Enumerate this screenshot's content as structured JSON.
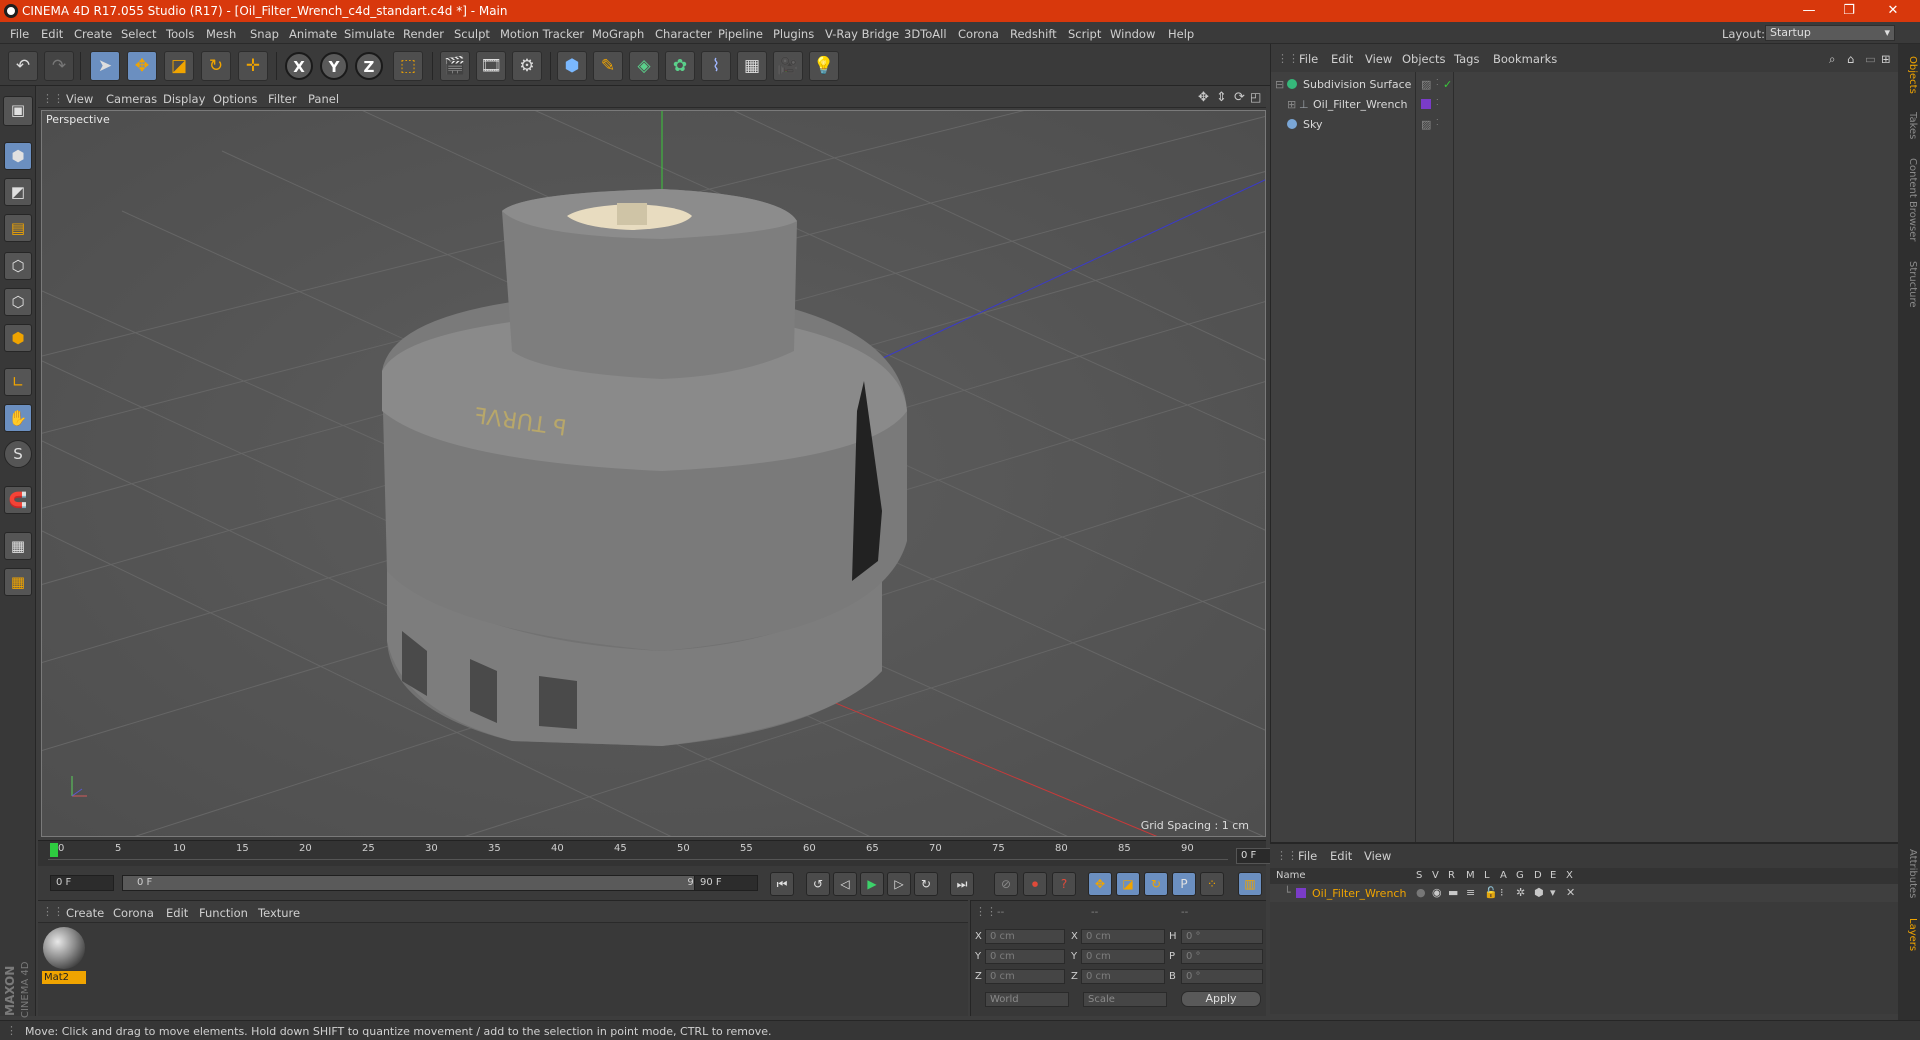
{
  "window": {
    "title": "CINEMA 4D R17.055 Studio (R17) - [Oil_Filter_Wrench_c4d_standart.c4d *] - Main",
    "min_symbol": "—",
    "restore_symbol": "❐",
    "close_symbol": "✕"
  },
  "menubar": {
    "items": [
      "File",
      "Edit",
      "Create",
      "Select",
      "Tools",
      "Mesh",
      "Snap",
      "Animate",
      "Simulate",
      "Render",
      "Sculpt",
      "Motion Tracker",
      "MoGraph",
      "Character",
      "Pipeline",
      "Plugins",
      "V-Ray Bridge",
      "3DToAll",
      "Corona",
      "Redshift",
      "Script",
      "Window",
      "Help"
    ],
    "layout_label": "Layout:",
    "layout_value": "Startup"
  },
  "toolbar": {
    "x_label": "X",
    "y_label": "Y",
    "z_label": "Z"
  },
  "viewport": {
    "menu": [
      "View",
      "Cameras",
      "Display",
      "Options",
      "Filter",
      "Panel"
    ],
    "label": "Perspective",
    "grid_spacing": "Grid Spacing : 1 cm"
  },
  "timeline": {
    "ticks": [
      "0",
      "5",
      "10",
      "15",
      "20",
      "25",
      "30",
      "35",
      "40",
      "45",
      "50",
      "55",
      "60",
      "65",
      "70",
      "75",
      "80",
      "85",
      "90"
    ],
    "current_frame": "0 F",
    "start_field": "0 F",
    "range_start": "0 F",
    "range_end": "90 F",
    "end_field": "90 F"
  },
  "materials": {
    "menu": [
      "Create",
      "Corona",
      "Edit",
      "Function",
      "Texture"
    ],
    "items": [
      {
        "name": "Mat2"
      }
    ]
  },
  "coordinates": {
    "header": [
      "--",
      "--",
      "--"
    ],
    "rows": [
      {
        "a_label": "X",
        "a_val": "0 cm",
        "b_label": "X",
        "b_val": "0 cm",
        "c_label": "H",
        "c_val": "0 °"
      },
      {
        "a_label": "Y",
        "a_val": "0 cm",
        "b_label": "Y",
        "b_val": "0 cm",
        "c_label": "P",
        "c_val": "0 °"
      },
      {
        "a_label": "Z",
        "a_val": "0 cm",
        "b_label": "Z",
        "b_val": "0 cm",
        "c_label": "B",
        "c_val": "0 °"
      }
    ],
    "mode1": "World",
    "mode2": "Scale",
    "apply": "Apply"
  },
  "status": {
    "text": "Move: Click and drag to move elements. Hold down SHIFT to quantize movement / add to the selection in point mode, CTRL to remove."
  },
  "object_manager": {
    "menu": [
      "File",
      "Edit",
      "View",
      "Objects",
      "Tags",
      "Bookmarks"
    ],
    "objects": [
      {
        "name": "Subdivision Surface",
        "icon_color": "#36b87a"
      },
      {
        "name": "Oil_Filter_Wrench",
        "icon_color": "#9aa0a8"
      },
      {
        "name": "Sky",
        "icon_color": "#7aa6d6"
      }
    ]
  },
  "layer_manager": {
    "menu": [
      "File",
      "Edit",
      "View"
    ],
    "columns": [
      "Name",
      "S",
      "V",
      "R",
      "M",
      "L",
      "A",
      "G",
      "D",
      "E",
      "X"
    ],
    "layers": [
      {
        "name": "Oil_Filter_Wrench",
        "color": "#7a3cc8"
      }
    ]
  },
  "side_tabs": [
    "Objects",
    "Takes",
    "Content Browser",
    "Structure",
    "Attributes",
    "Layers"
  ],
  "branding": {
    "line1": "MAXON",
    "line2": "CINEMA 4D"
  },
  "colors": {
    "accent": "#d8380c",
    "highlight": "#f0a400",
    "active_tool": "#6b8fc0"
  }
}
